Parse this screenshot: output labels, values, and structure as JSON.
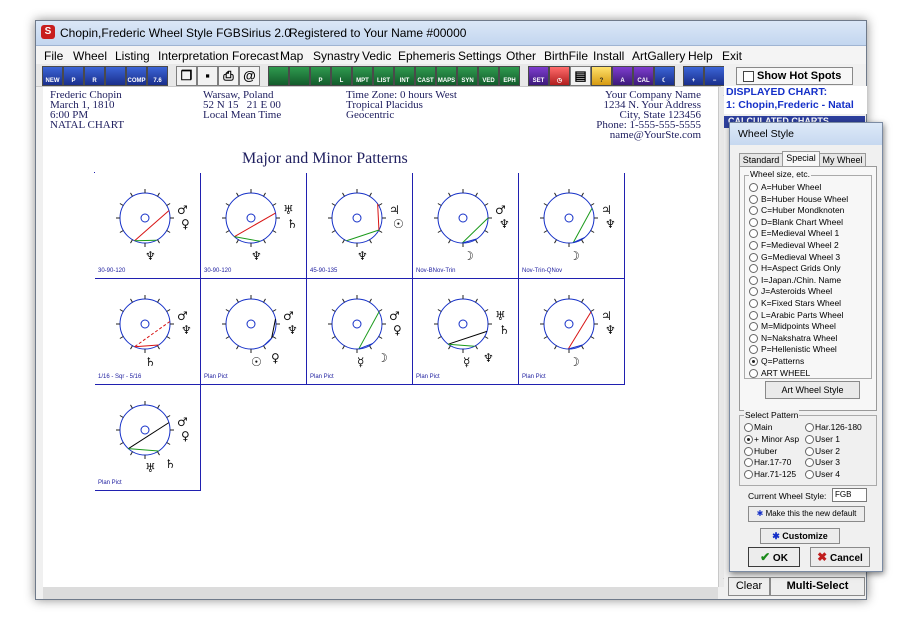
{
  "window": {
    "title": "Chopin,Frederic Wheel Style FGB",
    "app_version": "Sirius 2.0",
    "registration": "Registered to Your Name  #00000"
  },
  "menu": [
    "File",
    "Wheel",
    "Listing",
    "Interpretation",
    "Forecast",
    "Map",
    "Synastry",
    "Vedic",
    "Ephemeris",
    "Settings",
    "Other",
    "BirthFile",
    "Install",
    "ArtGallery",
    "Help",
    "Exit"
  ],
  "toolbar": {
    "icons": [
      {
        "name": "new-chart-icon",
        "text": "NEW"
      },
      {
        "name": "progressed-icon",
        "text": "P"
      },
      {
        "name": "return-icon",
        "text": "R"
      },
      {
        "name": "transit-icon",
        "text": ""
      },
      {
        "name": "composite-icon",
        "text": "COMP"
      },
      {
        "name": "version-icon",
        "text": "7.6"
      },
      {
        "name": "windows-icon",
        "text": "❐"
      },
      {
        "name": "save-icon",
        "text": "▪"
      },
      {
        "name": "print-icon",
        "text": "⎙"
      },
      {
        "name": "email-icon",
        "text": "@"
      },
      {
        "name": "wheel-icon",
        "text": ""
      },
      {
        "name": "wheel2-icon",
        "text": ""
      },
      {
        "name": "planet-list-icon",
        "text": "P"
      },
      {
        "name": "lunar-icon",
        "text": "L"
      },
      {
        "name": "midpoint-icon",
        "text": "MPT"
      },
      {
        "name": "list-icon",
        "text": "LIST"
      },
      {
        "name": "interpret-icon",
        "text": "INT"
      },
      {
        "name": "cast-icon",
        "text": "CAST"
      },
      {
        "name": "maps-icon",
        "text": "MAPS"
      },
      {
        "name": "synastry-icon",
        "text": "SYN"
      },
      {
        "name": "vedic-icon",
        "text": "VED"
      },
      {
        "name": "ephemeris-icon",
        "text": "EPH"
      },
      {
        "name": "settings-icon",
        "text": "SET"
      },
      {
        "name": "clock-icon",
        "text": "◷"
      },
      {
        "name": "document-icon",
        "text": "▤"
      },
      {
        "name": "help-icon",
        "text": "?"
      },
      {
        "name": "art-icon",
        "text": "A"
      },
      {
        "name": "calendar-icon",
        "text": "CAL"
      },
      {
        "name": "moon-icon",
        "text": "☾"
      },
      {
        "name": "zoom-in-icon",
        "text": "+"
      },
      {
        "name": "zoom-out-icon",
        "text": "−"
      }
    ]
  },
  "chart_header": {
    "name": "Frederic Chopin",
    "date": "March 1, 1810",
    "time": "6:00 PM",
    "chart_type": "NATAL CHART",
    "place": "Warsaw, Poland",
    "coords": "52 N 15   21 E 00",
    "time_type": "Local Mean Time",
    "timezone": "Time Zone: 0 hours West",
    "zodiac_house": "Tropical Placidus",
    "centric": "Geocentric",
    "company": "Your Company Name",
    "address": "1234 N. Your Address",
    "city": "City, State 123456",
    "phone": "Phone: 1-555-555-5555",
    "email": "name@YourSte.com"
  },
  "page_title": "Major and Minor Patterns",
  "patterns": [
    {
      "label": "30-90-120",
      "glyphs": [
        "♂",
        "♀",
        "♆"
      ],
      "line": "#d81414",
      "line2": "#1b9a1b"
    },
    {
      "label": "30-90-120",
      "glyphs": [
        "♅",
        "♄",
        "♆"
      ],
      "line": "#d81414",
      "line2": "#1b9a1b"
    },
    {
      "label": "45-90-135",
      "glyphs": [
        "♃",
        "☉",
        "♆"
      ],
      "line": "#d81414",
      "line2": "#1b9a1b"
    },
    {
      "label": "Nov-BNov-Trin",
      "glyphs": [
        "♂",
        "♆",
        "☽"
      ],
      "line": "#1b9a1b",
      "line2": "#1530c8"
    },
    {
      "label": "Nov-Trin-QNov",
      "glyphs": [
        "♃",
        "♆",
        "☽"
      ],
      "line": "#1b9a1b",
      "line2": "#1530c8"
    },
    {
      "label": "1/16 - Sqr - 5/16",
      "glyphs": [
        "♂",
        "♆",
        "♄"
      ],
      "line": "#d81414",
      "line2": "#d81414"
    },
    {
      "label": "Plan Pict",
      "glyphs": [
        "♂",
        "♆",
        "☉",
        "♀"
      ],
      "line": "#000000",
      "line2": "#1530c8"
    },
    {
      "label": "Plan Pict",
      "glyphs": [
        "♂",
        "♀",
        "☿",
        "☽"
      ],
      "line": "#1b9a1b",
      "line2": "#1530c8"
    },
    {
      "label": "Plan Pict",
      "glyphs": [
        "♅",
        "♄",
        "☿",
        "♆"
      ],
      "line": "#000000",
      "line2": "#1b9a1b"
    },
    {
      "label": "Plan Pict",
      "glyphs": [
        "♃",
        "♆",
        "☽"
      ],
      "line": "#d81414",
      "line2": "#1530c8"
    },
    {
      "label": "Plan Pict",
      "glyphs": [
        "♂",
        "♀",
        "♅",
        "♄"
      ],
      "line": "#000000",
      "line2": "#1b9a1b"
    }
  ],
  "right_panel": {
    "hot_spots_label": "Show Hot Spots",
    "displayed_chart_label": "DISPLAYED CHART:",
    "displayed_chart_value": "1: Chopin,Frederic - Natal",
    "calculated_label": "CALCULATED CHARTS",
    "clear_label": "Clear",
    "multi_select_label": "Multi-Select"
  },
  "dialog": {
    "title": "Wheel Style",
    "tabs": [
      "Standard",
      "Special",
      "My Wheel"
    ],
    "active_tab": "Special",
    "wheel_group_label": "Wheel size, etc.",
    "wheel_options": [
      "A=Huber Wheel",
      "B=Huber House Wheel",
      "C=Huber Mondknoten",
      "D=Blank Chart Wheel",
      "E=Medieval Wheel 1",
      "F=Medieval Wheel 2",
      "G=Medieval Wheel 3",
      "H=Aspect Grids Only",
      "I=Japan./Chin. Name",
      "J=Asteroids Wheel",
      "K=Fixed Stars Wheel",
      "L=Arabic Parts Wheel",
      "M=Midpoints Wheel",
      "N=Nakshatra Wheel",
      "P=Hellenistic Wheel",
      "Q=Patterns",
      "ART WHEEL"
    ],
    "selected_wheel": "Q=Patterns",
    "art_wheel_style_label": "Art Wheel Style",
    "pattern_group_label": "Select Pattern",
    "pattern_left": [
      "Main",
      "+ Minor Asp",
      "Huber",
      "Har.17-70",
      "Har.71-125"
    ],
    "pattern_right": [
      "Har.126-180",
      "User 1",
      "User 2",
      "User 3",
      "User 4"
    ],
    "selected_pattern": "+ Minor Asp",
    "current_wheel_style_label": "Current Wheel Style:",
    "current_wheel_style_value": "FGB",
    "make_default_label": "Make this the new default",
    "customize_label": "Customize",
    "ok_label": "OK",
    "cancel_label": "Cancel"
  },
  "colors": {
    "accent": "#2d3f9d",
    "grid_line": "#2020b0",
    "wheel_stroke": "#1530c8",
    "header_text": "#202060"
  }
}
